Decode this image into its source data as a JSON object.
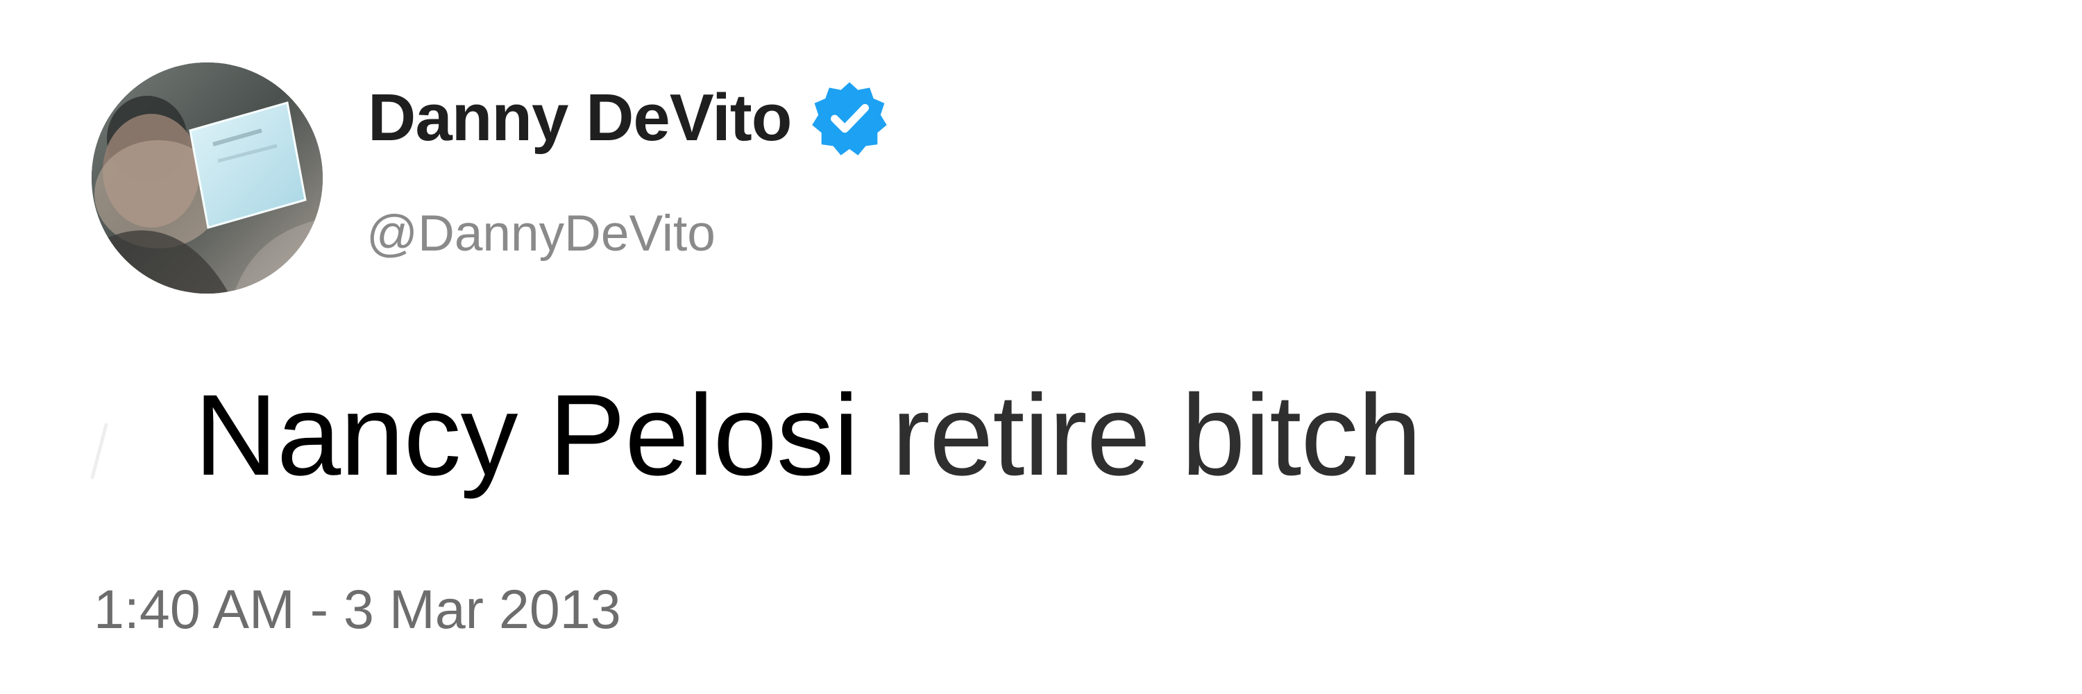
{
  "tweet": {
    "author": {
      "display_name": "Danny DeVito",
      "username": "@DannyDeVito",
      "verified_icon": "verified-badge-icon",
      "avatar": "avatar-photo"
    },
    "text": {
      "primary": "Nancy Pelosi",
      "secondary": "retire bitch"
    },
    "timestamp": "1:40 AM - 3 Mar 2013"
  },
  "colors": {
    "verified_blue": "#1da1f2",
    "display_name": "#1f1f1f",
    "username": "#8a8a8a",
    "timestamp": "#6d6d6d"
  }
}
